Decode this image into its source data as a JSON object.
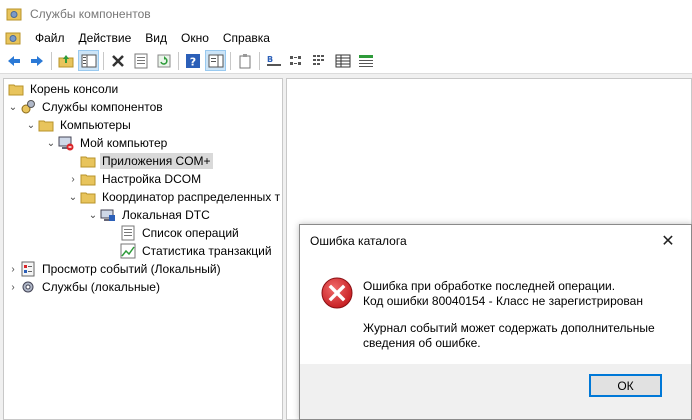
{
  "window": {
    "title": "Службы компонентов"
  },
  "menu": {
    "items": [
      "Файл",
      "Действие",
      "Вид",
      "Окно",
      "Справка"
    ]
  },
  "toolbar": {
    "buttons": [
      "back-arrow-icon",
      "forward-arrow-icon",
      "folder-up-icon",
      "show-hide-tree-icon",
      "delete-icon",
      "properties-icon",
      "refresh-icon",
      "help-icon",
      "action-pane-icon",
      "export-icon",
      "large-icons-view-icon",
      "small-icons-view-icon",
      "list-view-icon",
      "details-view-icon",
      "status-view-icon"
    ]
  },
  "tree": {
    "items": [
      {
        "label": "Корень консоли",
        "level": 0,
        "expand": "none",
        "icon": "folder-icon"
      },
      {
        "label": "Службы компонентов",
        "level": 0,
        "expand": "open",
        "icon": "component-services-icon"
      },
      {
        "label": "Компьютеры",
        "level": 1,
        "expand": "open",
        "icon": "folder-icon"
      },
      {
        "label": "Мой компьютер",
        "level": 2,
        "expand": "open",
        "icon": "my-computer-icon"
      },
      {
        "label": "Приложения COM+",
        "level": 3,
        "expand": "none",
        "icon": "folder-icon",
        "selected": true
      },
      {
        "label": "Настройка DCOM",
        "level": 3,
        "expand": "closed",
        "icon": "folder-icon"
      },
      {
        "label": "Координатор распределенных т",
        "level": 3,
        "expand": "open",
        "icon": "folder-icon"
      },
      {
        "label": "Локальная DTC",
        "level": 4,
        "expand": "open",
        "icon": "local-dtc-icon"
      },
      {
        "label": "Список операций",
        "level": 5,
        "expand": "none",
        "icon": "transaction-list-icon"
      },
      {
        "label": "Статистика транзакций",
        "level": 5,
        "expand": "none",
        "icon": "statistics-icon"
      },
      {
        "label": "Просмотр событий (Локальный)",
        "level": 0,
        "expand": "closed",
        "icon": "event-viewer-icon"
      },
      {
        "label": "Службы (локальные)",
        "level": 0,
        "expand": "closed",
        "icon": "services-icon"
      }
    ]
  },
  "dialog": {
    "title": "Ошибка каталога",
    "line1": "Ошибка при обработке последней операции.",
    "line2": "Код ошибки 80040154 - Класс не зарегистрирован",
    "line3": "Журнал событий может содержать дополнительные",
    "line4": "сведения об ошибке.",
    "ok_label": "ОК",
    "close_glyph": "✕"
  },
  "colors": {
    "folder": "#e8c45c",
    "error_red": "#d9262a",
    "accent": "#0078d7"
  }
}
